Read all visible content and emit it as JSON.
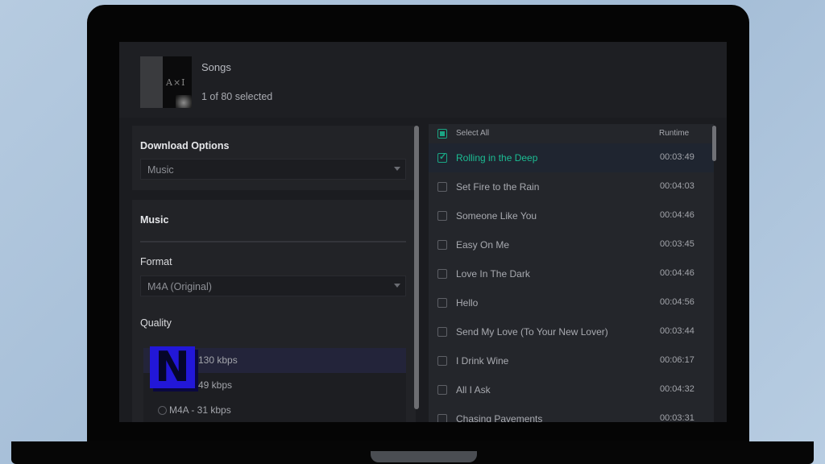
{
  "header": {
    "album_art_text": "A×I",
    "title": "Songs",
    "selection_count": "1 of 80 selected"
  },
  "options": {
    "download_heading": "Download Options",
    "download_value": "Music",
    "music_heading": "Music",
    "format_label": "Format",
    "format_value": "M4A (Original)",
    "quality_label": "Quality",
    "quality_options": [
      "130 kbps",
      "49 kbps",
      "M4A - 31 kbps"
    ],
    "overlay_logo_letter": "N"
  },
  "song_list": {
    "select_all_label": "Select All",
    "runtime_header": "Runtime",
    "songs": [
      {
        "title": "Rolling in the Deep",
        "runtime": "00:03:49",
        "checked": true
      },
      {
        "title": "Set Fire to the Rain",
        "runtime": "00:04:03",
        "checked": false
      },
      {
        "title": "Someone Like You",
        "runtime": "00:04:46",
        "checked": false
      },
      {
        "title": "Easy On Me",
        "runtime": "00:03:45",
        "checked": false
      },
      {
        "title": "Love In The Dark",
        "runtime": "00:04:46",
        "checked": false
      },
      {
        "title": "Hello",
        "runtime": "00:04:56",
        "checked": false
      },
      {
        "title": "Send My Love (To Your New Lover)",
        "runtime": "00:03:44",
        "checked": false
      },
      {
        "title": "I Drink Wine",
        "runtime": "00:06:17",
        "checked": false
      },
      {
        "title": "All I Ask",
        "runtime": "00:04:32",
        "checked": false
      },
      {
        "title": "Chasing Pavements",
        "runtime": "00:03:31",
        "checked": false
      }
    ]
  },
  "colors": {
    "accent": "#1aa684",
    "background": "#1b1c20",
    "logo_blue": "#2217d8"
  }
}
